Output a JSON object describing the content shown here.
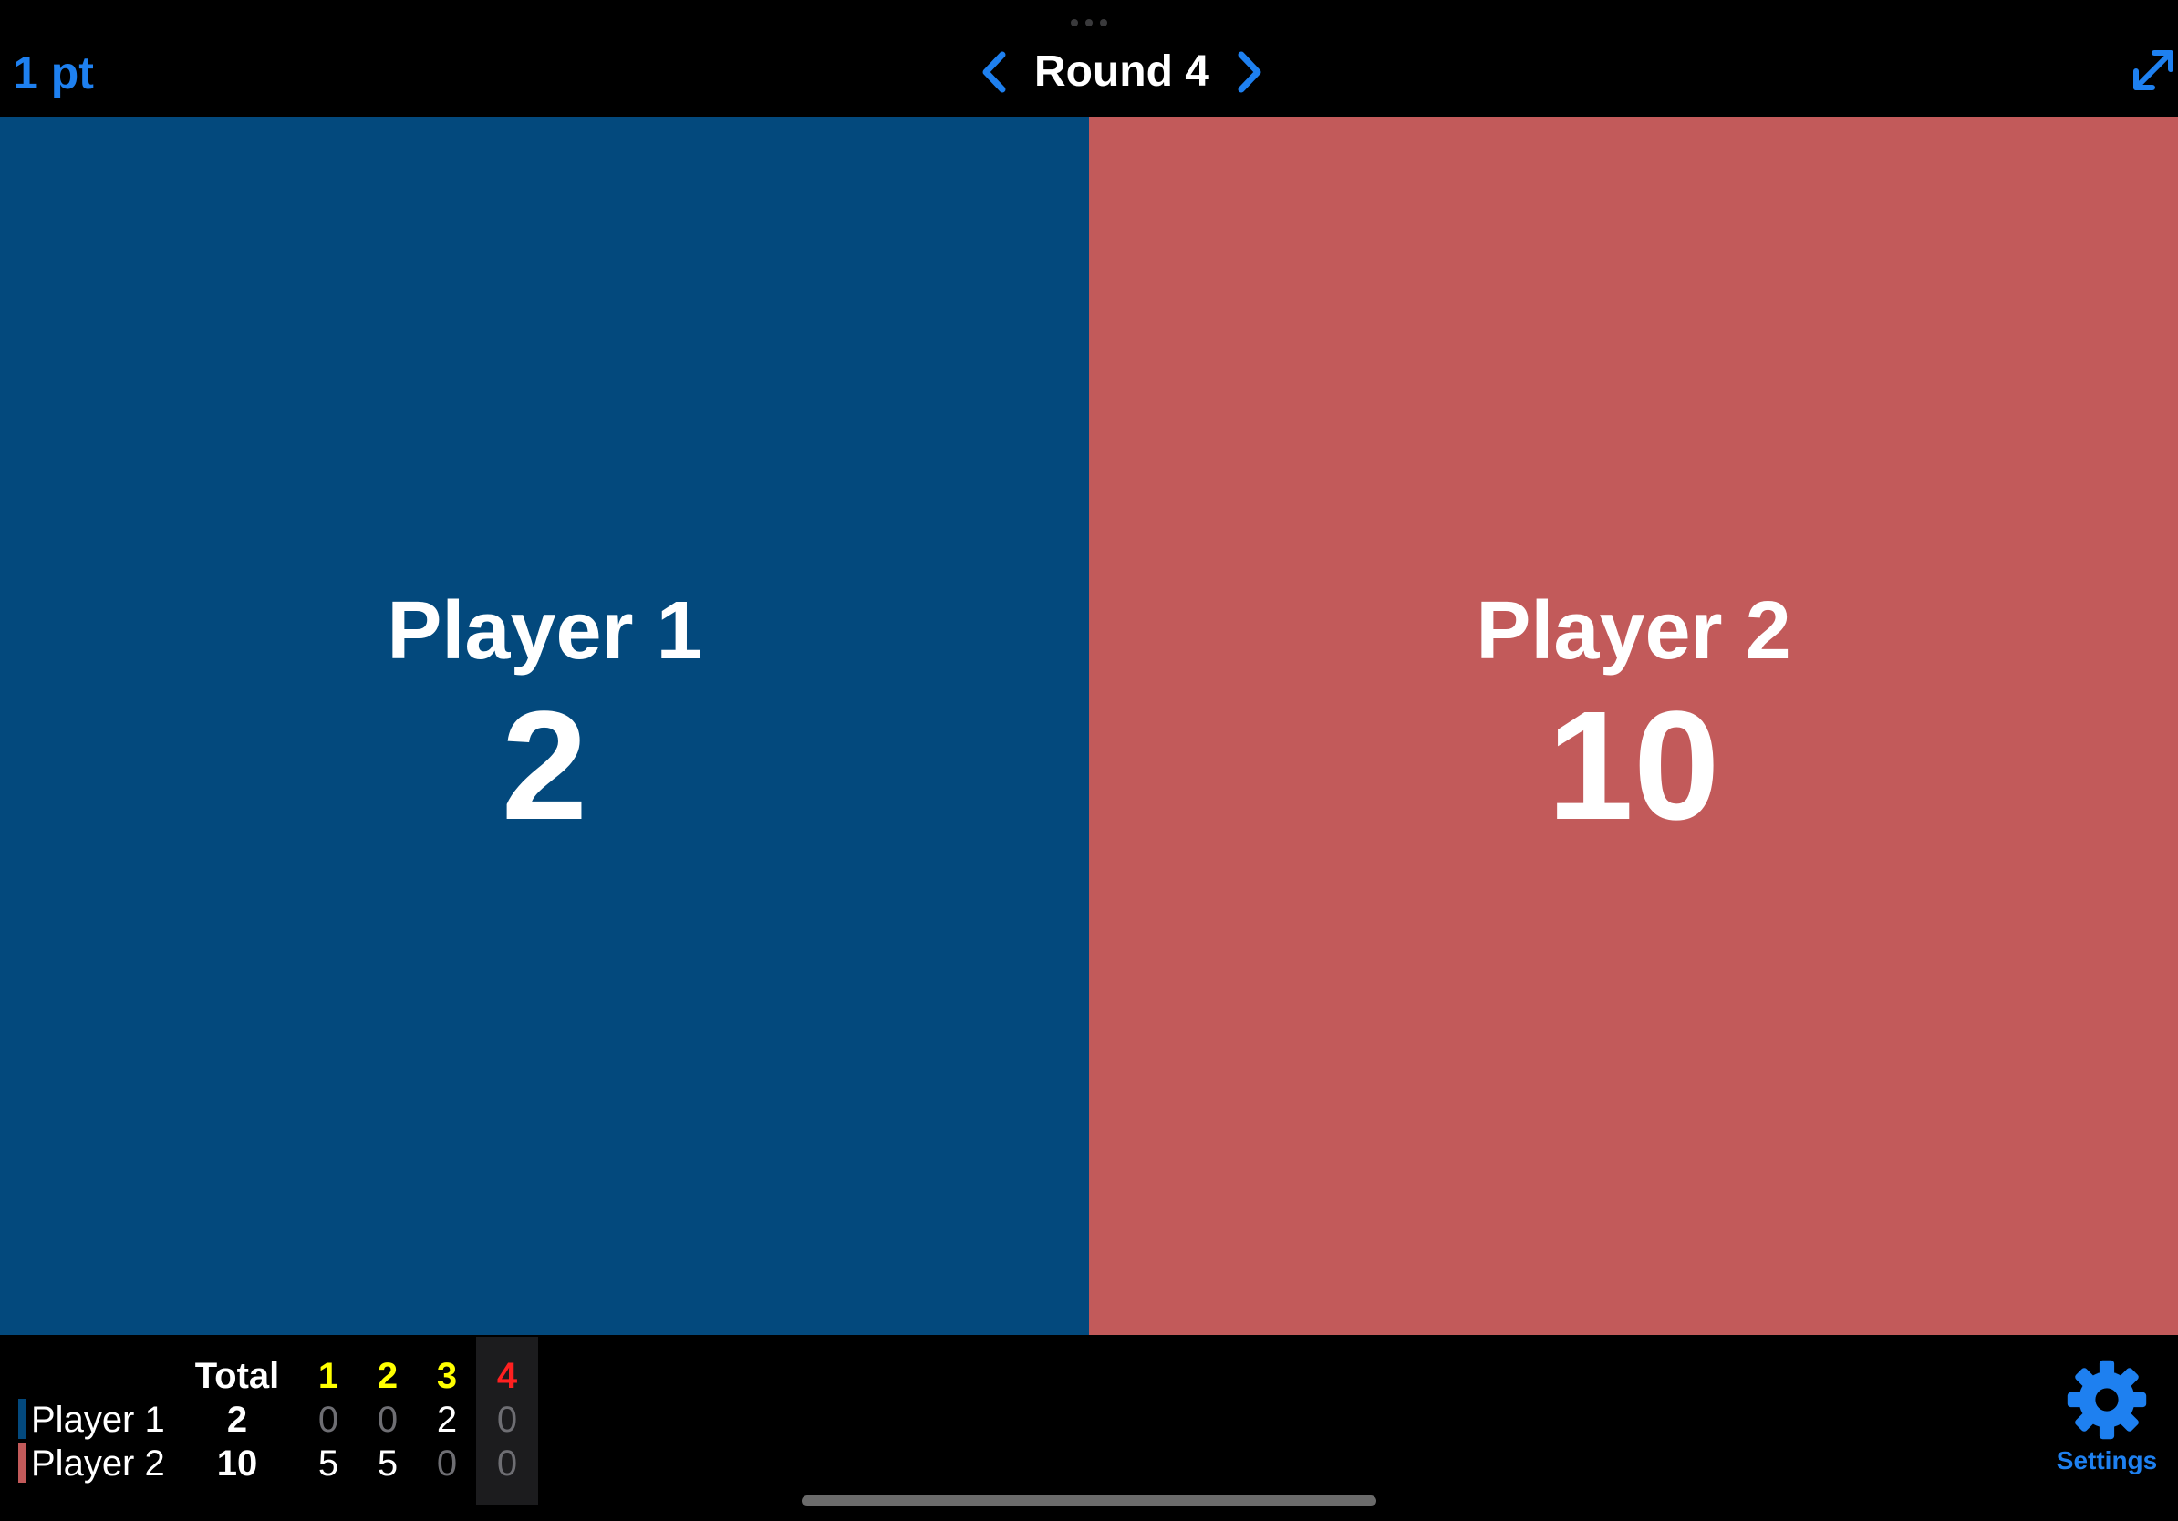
{
  "header": {
    "points_label": "1 pt",
    "round_title": "Round 4",
    "prev_icon": "chevron-left-icon",
    "next_icon": "chevron-right-icon",
    "expand_icon": "expand-icon"
  },
  "players": [
    {
      "name": "Player 1",
      "score": "2",
      "color": "#03497d"
    },
    {
      "name": "Player 2",
      "score": "10",
      "color": "#c25a5a"
    }
  ],
  "scoreboard": {
    "total_header": "Total",
    "rounds": [
      {
        "label": "1",
        "color": "#ffff00"
      },
      {
        "label": "2",
        "color": "#ffff00"
      },
      {
        "label": "3",
        "color": "#ffff00"
      },
      {
        "label": "4",
        "color": "#ff2020"
      }
    ],
    "rows": [
      {
        "name": "Player 1",
        "total": "2",
        "rounds": [
          "0",
          "0",
          "2",
          "0"
        ]
      },
      {
        "name": "Player 2",
        "total": "10",
        "rounds": [
          "5",
          "5",
          "0",
          "0"
        ]
      }
    ],
    "current_round_index": 3
  },
  "settings": {
    "label": "Settings",
    "icon": "gear-icon"
  },
  "colors": {
    "accent": "#1e80f0",
    "zero_text": "#6e6e73"
  }
}
